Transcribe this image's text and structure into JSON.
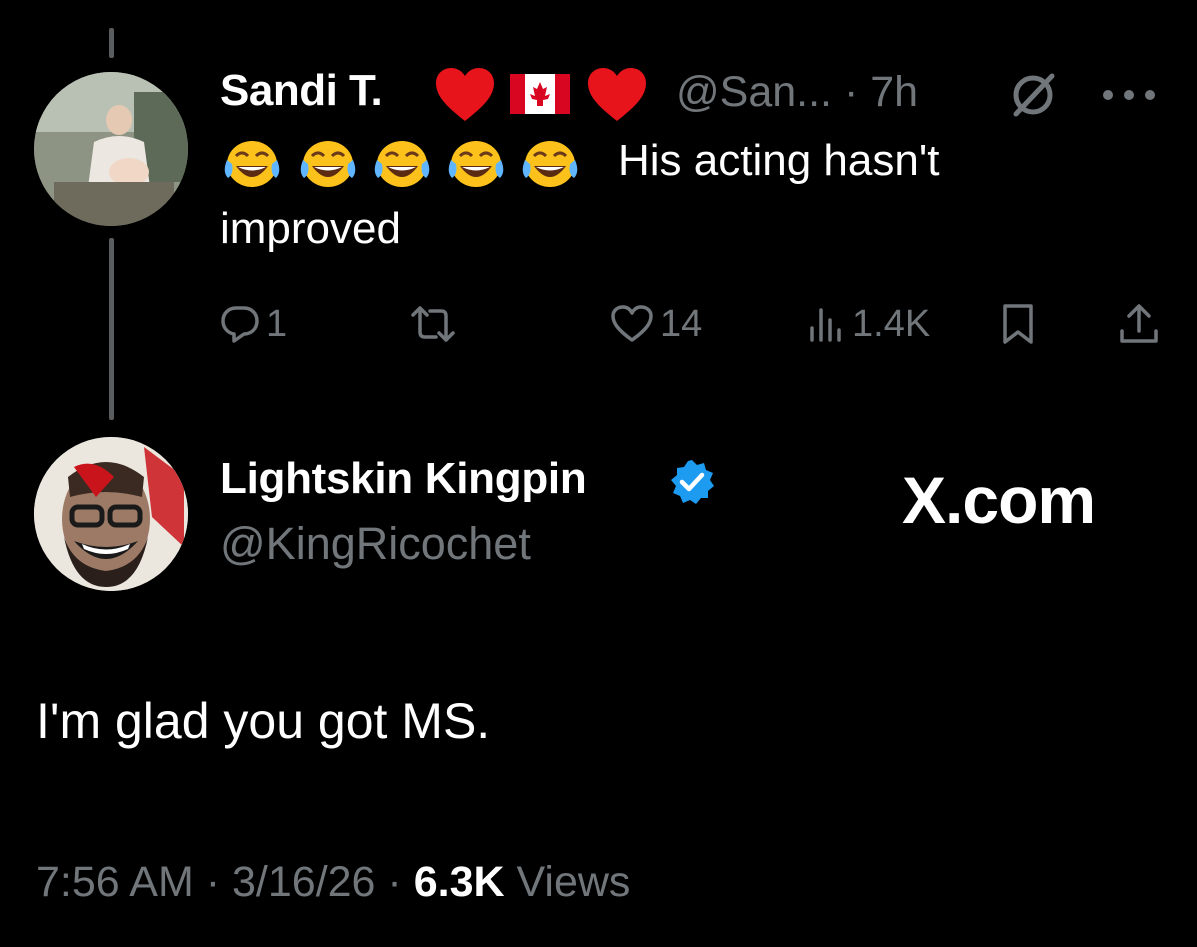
{
  "reply_parent": {
    "display_name": "Sandi T.",
    "handle_time": "@San... · 7h",
    "text_line1": "His acting hasn't",
    "text_line2": "improved",
    "emoji_count_label": "😂",
    "actions": {
      "replies": "1",
      "reposts": "",
      "likes": "14",
      "views": "1.4K"
    }
  },
  "main_post": {
    "display_name": "Lightskin Kingpin",
    "handle": "@KingRicochet",
    "watermark": "X.com",
    "text": "I'm glad you got MS.",
    "time": "7:56 AM",
    "date": "3/16/26",
    "views_count": "6.3K",
    "views_label": "Views"
  },
  "colors": {
    "background": "#000000",
    "text_primary": "#ffffff",
    "text_secondary": "#71767b",
    "heart": "#e8141b",
    "verified": "#1d9bf0"
  },
  "icons": [
    "reply-icon",
    "repost-icon",
    "like-icon",
    "views-icon",
    "bookmark-icon",
    "share-icon",
    "grok-icon",
    "more-icon",
    "verified-icon"
  ]
}
